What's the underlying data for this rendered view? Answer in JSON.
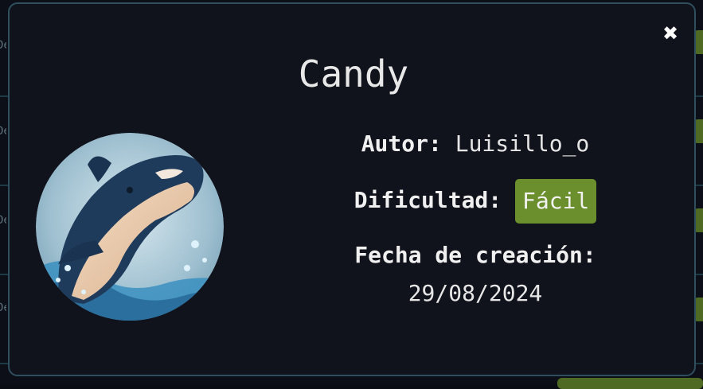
{
  "modal": {
    "title": "Candy",
    "close_icon": "close-icon",
    "avatar_icon": "orca-whale-avatar",
    "author_label": "Autor:",
    "author_value": "Luisillo_o",
    "difficulty_label": "Dificultad:",
    "difficulty_value": "Fácil",
    "date_label": "Fecha de creación:",
    "date_value": "29/08/2024"
  },
  "background": {
    "row_fragment": "De"
  },
  "colors": {
    "modal_bg": "#11131c",
    "modal_border": "#2f4f5e",
    "difficulty_badge": "#6b8f2c",
    "text": "#e8e8e8"
  }
}
